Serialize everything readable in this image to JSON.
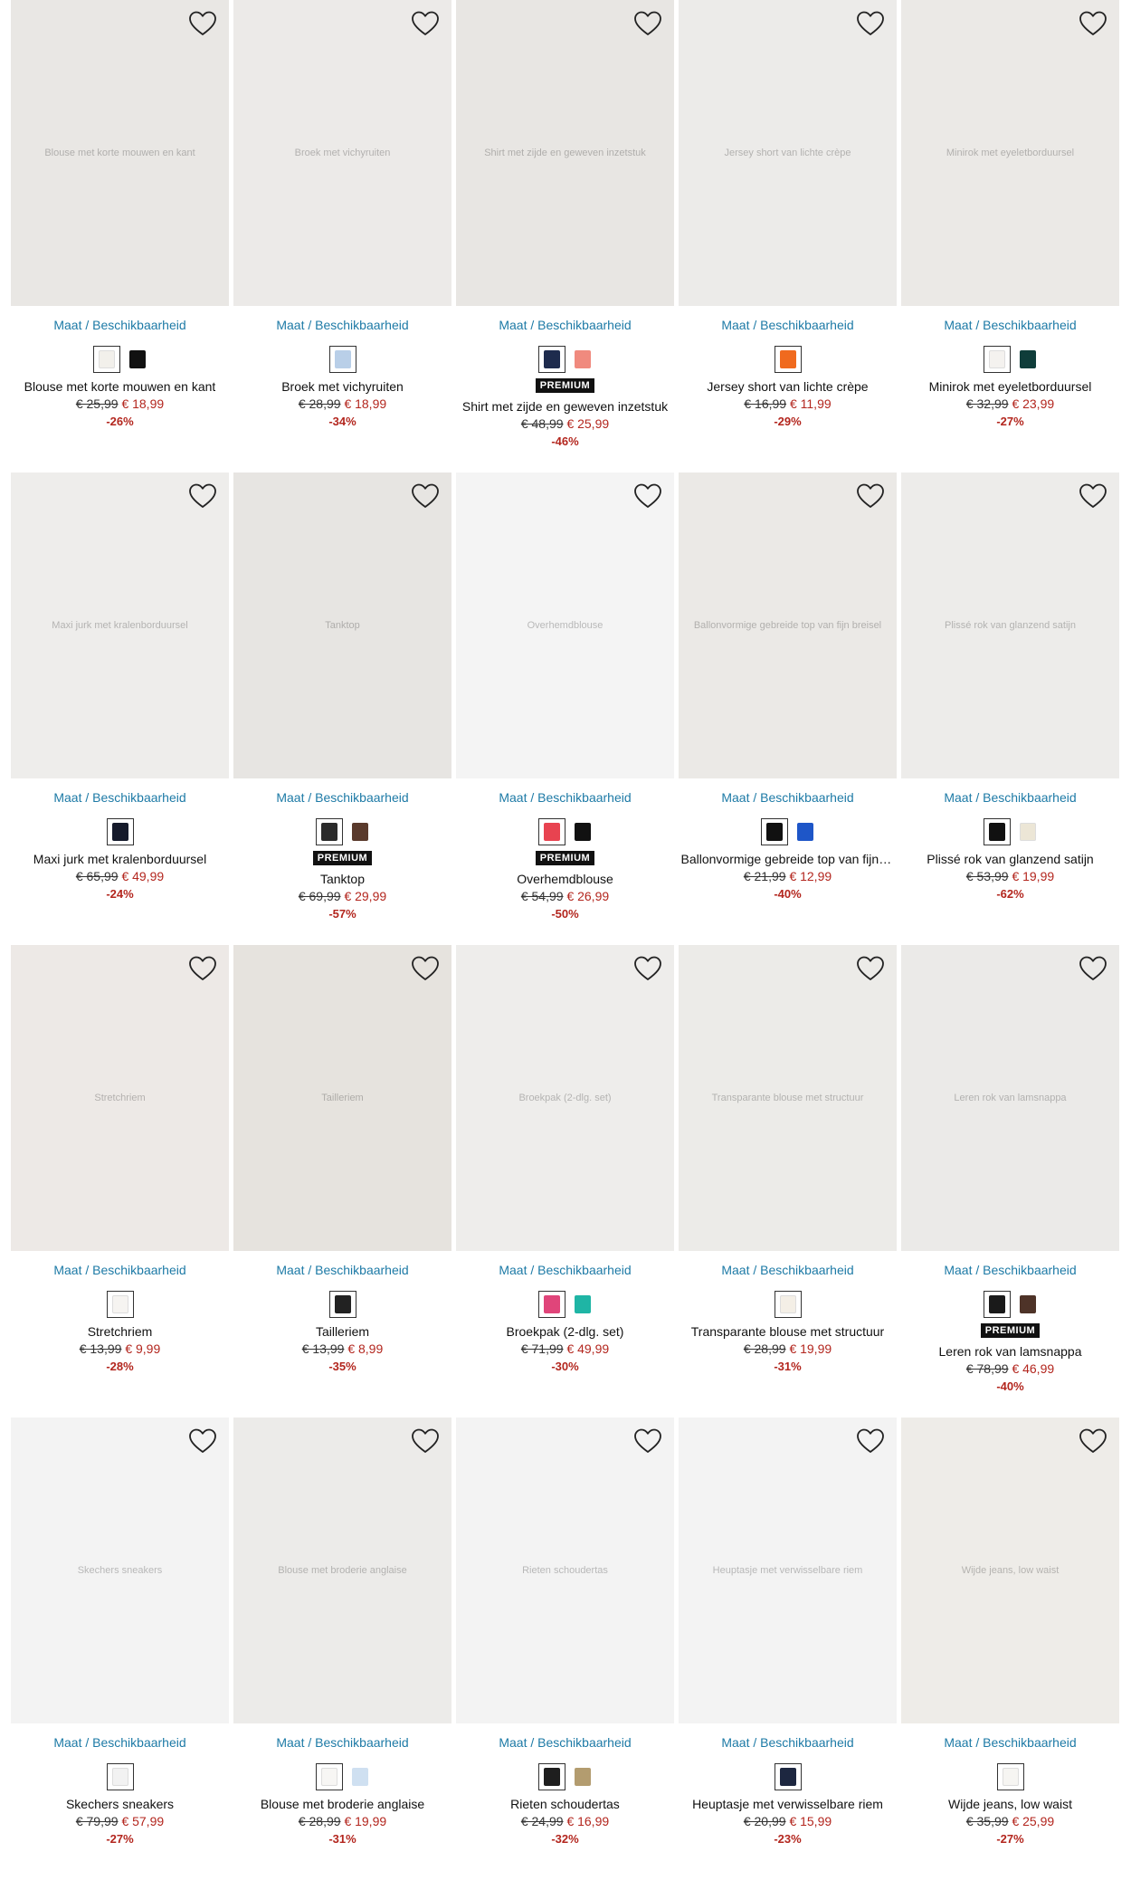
{
  "size_link_label": "Maat / Beschikbaarheid",
  "products": [
    {
      "name": "Blouse met korte mouwen en kant",
      "old_price": "€ 25,99",
      "new_price": "€ 18,99",
      "discount": "-26%",
      "premium": false,
      "photo": "Blouse met korte mouwen en kant",
      "bg": "#e9e7e4",
      "swatches": [
        "#f2f0eb",
        "#111111"
      ]
    },
    {
      "name": "Broek met vichyruiten",
      "old_price": "€ 28,99",
      "new_price": "€ 18,99",
      "discount": "-34%",
      "premium": false,
      "photo": "Broek met vichyruiten",
      "bg": "#eceae8",
      "swatches": [
        "#b9cfe8"
      ]
    },
    {
      "name": "Shirt met zijde en geweven inzetstuk",
      "old_price": "€ 48,99",
      "new_price": "€ 25,99",
      "discount": "-46%",
      "premium": true,
      "photo": "Shirt met zijde en geweven inzetstuk",
      "bg": "#e8e6e3",
      "swatches": [
        "#1e2b4d",
        "#f08a7e"
      ]
    },
    {
      "name": "Jersey short van lichte crèpe",
      "old_price": "€ 16,99",
      "new_price": "€ 11,99",
      "discount": "-29%",
      "premium": false,
      "photo": "Jersey short van lichte crèpe",
      "bg": "#ecebe9",
      "swatches": [
        "#f06a1e"
      ]
    },
    {
      "name": "Minirok met eyeletborduursel",
      "old_price": "€ 32,99",
      "new_price": "€ 23,99",
      "discount": "-27%",
      "premium": false,
      "photo": "Minirok met eyeletborduursel",
      "bg": "#ebe9e6",
      "swatches": [
        "#f4f2ef",
        "#0f3d3a"
      ]
    },
    {
      "name": "Maxi jurk met kralenborduursel",
      "old_price": "€ 65,99",
      "new_price": "€ 49,99",
      "discount": "-24%",
      "premium": false,
      "photo": "Maxi jurk met kralenborduursel",
      "bg": "#eeedeb",
      "swatches": [
        "#151a2b"
      ]
    },
    {
      "name": "Tanktop",
      "old_price": "€ 69,99",
      "new_price": "€ 29,99",
      "discount": "-57%",
      "premium": true,
      "photo": "Tanktop",
      "bg": "#e7e5e2",
      "swatches": [
        "#2b2b2b",
        "#5a3a2c"
      ]
    },
    {
      "name": "Overhemdblouse",
      "old_price": "€ 54,99",
      "new_price": "€ 26,99",
      "discount": "-50%",
      "premium": true,
      "photo": "Overhemdblouse",
      "bg": "#f4f4f4",
      "swatches": [
        "#e84350",
        "#111111"
      ]
    },
    {
      "name": "Ballonvormige gebreide top van fijn breisel",
      "old_price": "€ 21,99",
      "new_price": "€ 12,99",
      "discount": "-40%",
      "premium": false,
      "photo": "Ballonvormige gebreide top van fijn breisel",
      "bg": "#ebe9e6",
      "swatches": [
        "#111111",
        "#1e56c8"
      ]
    },
    {
      "name": "Plissé rok van glanzend satijn",
      "old_price": "€ 53,99",
      "new_price": "€ 19,99",
      "discount": "-62%",
      "premium": false,
      "photo": "Plissé rok van glanzend satijn",
      "bg": "#edecea",
      "swatches": [
        "#111111",
        "#ece6d6"
      ]
    },
    {
      "name": "Stretchriem",
      "old_price": "€ 13,99",
      "new_price": "€ 9,99",
      "discount": "-28%",
      "premium": false,
      "photo": "Stretchriem",
      "bg": "#ede9e6",
      "swatches": [
        "#f6f4f1"
      ]
    },
    {
      "name": "Tailleriem",
      "old_price": "€ 13,99",
      "new_price": "€ 8,99",
      "discount": "-35%",
      "premium": false,
      "photo": "Tailleriem",
      "bg": "#e6e3de",
      "swatches": [
        "#222222"
      ]
    },
    {
      "name": "Broekpak (2-dlg. set)",
      "old_price": "€ 71,99",
      "new_price": "€ 49,99",
      "discount": "-30%",
      "premium": false,
      "photo": "Broekpak (2-dlg. set)",
      "bg": "#eeedeb",
      "swatches": [
        "#e0457a",
        "#1fb5a5"
      ]
    },
    {
      "name": "Transparante blouse met structuur",
      "old_price": "€ 28,99",
      "new_price": "€ 19,99",
      "discount": "-31%",
      "premium": false,
      "photo": "Transparante blouse met structuur",
      "bg": "#ecebe8",
      "swatches": [
        "#f4efe6"
      ]
    },
    {
      "name": "Leren rok van lamsnappa",
      "old_price": "€ 78,99",
      "new_price": "€ 46,99",
      "discount": "-40%",
      "premium": true,
      "photo": "Leren rok van lamsnappa",
      "bg": "#ebeae8",
      "swatches": [
        "#1a1a1a",
        "#4e3328"
      ]
    },
    {
      "name": "Skechers sneakers",
      "old_price": "€ 79,99",
      "new_price": "€ 57,99",
      "discount": "-27%",
      "premium": false,
      "photo": "Skechers sneakers",
      "bg": "#f3f3f3",
      "swatches": [
        "#f2f2f2"
      ]
    },
    {
      "name": "Blouse met broderie anglaise",
      "old_price": "€ 28,99",
      "new_price": "€ 19,99",
      "discount": "-31%",
      "premium": false,
      "photo": "Blouse met broderie anglaise",
      "bg": "#ecebe9",
      "swatches": [
        "#f7f6f4",
        "#cfe0f1"
      ]
    },
    {
      "name": "Rieten schoudertas",
      "old_price": "€ 24,99",
      "new_price": "€ 16,99",
      "discount": "-32%",
      "premium": false,
      "photo": "Rieten schoudertas",
      "bg": "#f3f3f3",
      "swatches": [
        "#1e1e1e",
        "#b39c6f"
      ]
    },
    {
      "name": "Heuptasje met verwisselbare riem",
      "old_price": "€ 20,99",
      "new_price": "€ 15,99",
      "discount": "-23%",
      "premium": false,
      "photo": "Heuptasje met verwisselbare riem",
      "bg": "#f3f3f3",
      "swatches": [
        "#1d2740"
      ]
    },
    {
      "name": "Wijde jeans, low waist",
      "old_price": "€ 35,99",
      "new_price": "€ 25,99",
      "discount": "-27%",
      "premium": false,
      "photo": "Wijde jeans, low waist",
      "bg": "#eeece8",
      "swatches": [
        "#f6f5f2"
      ]
    }
  ],
  "premium_label": "PREMIUM",
  "icons": {
    "wishlist": "heart-outline-icon"
  }
}
